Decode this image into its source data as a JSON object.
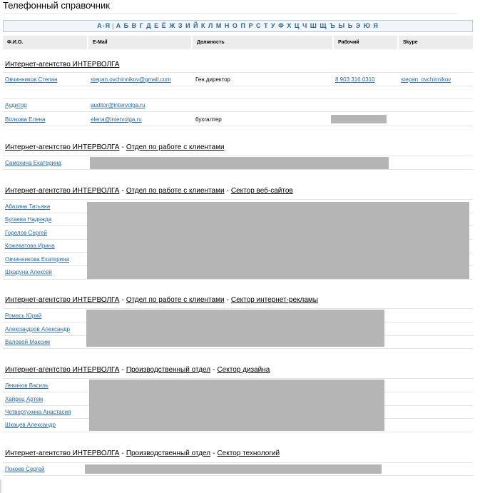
{
  "page": {
    "title": "Телефонный справочник"
  },
  "alphabet": {
    "all_label": "А-Я",
    "letters": [
      "А",
      "Б",
      "В",
      "Г",
      "Д",
      "Е",
      "Ё",
      "Ж",
      "З",
      "И",
      "Й",
      "К",
      "Л",
      "М",
      "Н",
      "О",
      "П",
      "Р",
      "С",
      "Т",
      "У",
      "Ф",
      "Х",
      "Ц",
      "Ч",
      "Ш",
      "Щ",
      "Ъ",
      "Ы",
      "Ь",
      "Э",
      "Ю",
      "Я"
    ]
  },
  "table": {
    "headers": {
      "name": "Ф.И.О.",
      "email": "E-Mail",
      "position": "Должность",
      "work": "Рабочий",
      "skype": "Skype"
    }
  },
  "groups": [
    {
      "path": [
        "Интернет-агентство ИНТЕРВОЛГА"
      ],
      "rows": [
        {
          "name": "Овчинников Степан",
          "email": "stepan.ovchinnikov@gmail.com",
          "position": "Ген.директор",
          "work": "8 903 316 0310",
          "skype": "stepan_ovchinnikov"
        },
        {
          "name": "Аудитор",
          "email": "auditor@intervolga.ru",
          "position": "",
          "work": "",
          "skype": ""
        },
        {
          "name": "Волкова Елена",
          "email": "elena@intervolga.ru",
          "position": "бухгалтер",
          "work": "",
          "skype": ""
        }
      ]
    },
    {
      "path": [
        "Интернет-агентство ИНТЕРВОЛГА",
        "Отдел по работе с клиентами"
      ],
      "rows": [
        {
          "name": "Самохина Екатерина"
        }
      ]
    },
    {
      "path": [
        "Интернет-агентство ИНТЕРВОЛГА",
        "Отдел по работе с клиентами",
        "Сектор веб-сайтов"
      ],
      "rows": [
        {
          "name": "Абазина Татьяна"
        },
        {
          "name": "Бугаева Надежда"
        },
        {
          "name": "Горелов Сергей"
        },
        {
          "name": "Кожеватова Ирина"
        },
        {
          "name": "Овчинникова Екатерина"
        },
        {
          "name": "Шкаруна Алексей"
        }
      ]
    },
    {
      "path": [
        "Интернет-агентство ИНТЕРВОЛГА",
        "Отдел по работе с клиентами",
        "Сектор интернет-рекламы"
      ],
      "rows": [
        {
          "name": "Ромась Юрий"
        },
        {
          "name": "Александров Александр"
        },
        {
          "name": "Валовой Максим"
        }
      ]
    },
    {
      "path": [
        "Интернет-агентство ИНТЕРВОЛГА",
        "Производственный отдел",
        "Сектор дизайна"
      ],
      "rows": [
        {
          "name": "Левинов Василь"
        },
        {
          "name": "Хайрец Артем"
        },
        {
          "name": "Четвертухина Анастасия"
        },
        {
          "name": "Шкацев Александр"
        }
      ]
    },
    {
      "path": [
        "Интернет-агентство ИНТЕРВОЛГА",
        "Производственный отдел",
        "Сектор технологий"
      ],
      "rows": [
        {
          "name": "Покоев Сергей"
        }
      ]
    }
  ]
}
